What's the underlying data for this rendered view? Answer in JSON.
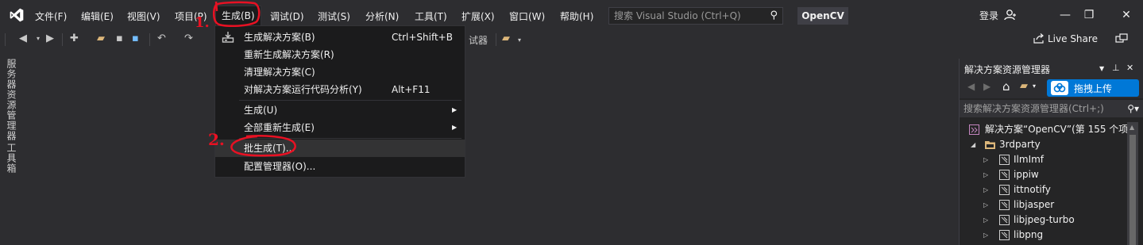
{
  "menu": {
    "items": [
      {
        "label": "文件(F)"
      },
      {
        "label": "编辑(E)"
      },
      {
        "label": "视图(V)"
      },
      {
        "label": "项目(P)"
      },
      {
        "label": "生成(B)"
      },
      {
        "label": "调试(D)"
      },
      {
        "label": "测试(S)"
      },
      {
        "label": "分析(N)"
      },
      {
        "label": "工具(T)"
      },
      {
        "label": "扩展(X)"
      },
      {
        "label": "窗口(W)"
      },
      {
        "label": "帮助(H)"
      }
    ],
    "search_placeholder": "搜索 Visual Studio (Ctrl+Q)",
    "solution_name": "OpenCV",
    "login_label": "登录"
  },
  "toolbar": {
    "partial_label": "试器",
    "live_share_label": "Live Share"
  },
  "side_tabs": {
    "server_explorer": "服务器资源管理器",
    "toolbox": "工具箱"
  },
  "build_menu": {
    "items": [
      {
        "label": "生成解决方案(B)",
        "shortcut": "Ctrl+Shift+B"
      },
      {
        "label": "重新生成解决方案(R)",
        "shortcut": ""
      },
      {
        "label": "清理解决方案(C)",
        "shortcut": ""
      },
      {
        "label": "对解决方案运行代码分析(Y)",
        "shortcut": "Alt+F11"
      },
      {
        "label": "生成(U)",
        "shortcut": ""
      },
      {
        "label": "全部重新生成(E)",
        "shortcut": ""
      },
      {
        "label": "批生成(T)...",
        "shortcut": ""
      },
      {
        "label": "配置管理器(O)...",
        "shortcut": ""
      }
    ]
  },
  "annotations": {
    "step1": "1.",
    "step2": "2."
  },
  "solution_explorer": {
    "title": "解决方案资源管理器",
    "upload_label": "拖拽上传",
    "search_placeholder": "搜索解决方案资源管理器(Ctrl+;)",
    "solution_node": "解决方案“OpenCV”(第 155 个项",
    "folder": "3rdparty",
    "projects": [
      "IlmImf",
      "ippiw",
      "ittnotify",
      "libjasper",
      "libjpeg-turbo",
      "libpng"
    ]
  },
  "colors": {
    "background": "#2d2d30",
    "menu_background": "#1b1b1c",
    "accent_blue": "#0078d7",
    "annotation_red": "#e81123",
    "vs_purple": "#ffffff"
  }
}
